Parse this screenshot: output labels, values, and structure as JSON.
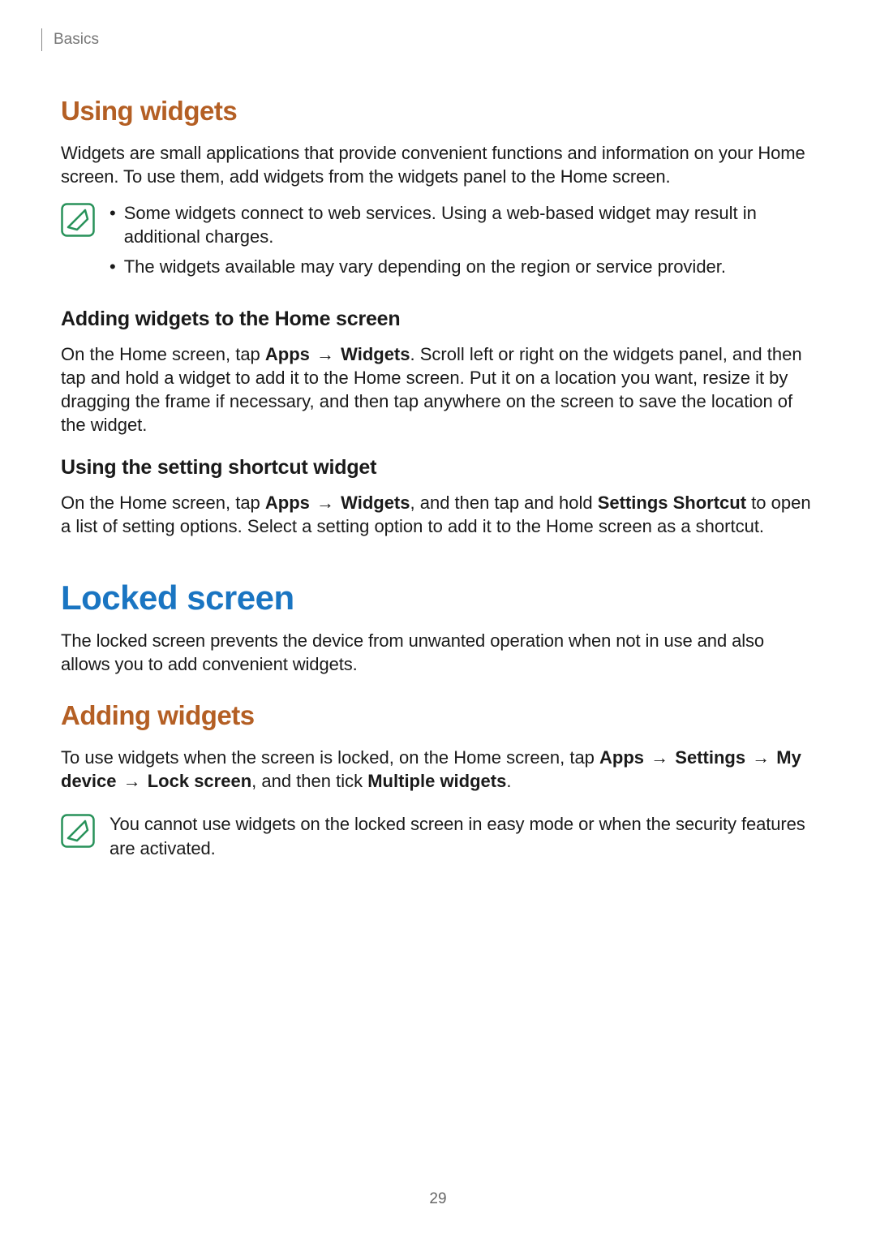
{
  "header": {
    "category": "Basics"
  },
  "section1": {
    "title": "Using widgets",
    "intro": "Widgets are small applications that provide convenient functions and information on your Home screen. To use them, add widgets from the widgets panel to the Home screen.",
    "notes": [
      "Some widgets connect to web services. Using a web-based widget may result in additional charges.",
      "The widgets available may vary depending on the region or service provider."
    ],
    "sub1": {
      "title": "Adding widgets to the Home screen",
      "segments": [
        {
          "t": "On the Home screen, tap ",
          "b": false
        },
        {
          "t": "Apps",
          "b": true
        },
        {
          "t": " → ",
          "b": false,
          "arrow": true
        },
        {
          "t": "Widgets",
          "b": true
        },
        {
          "t": ". Scroll left or right on the widgets panel, and then tap and hold a widget to add it to the Home screen. Put it on a location you want, resize it by dragging the frame if necessary, and then tap anywhere on the screen to save the location of the widget.",
          "b": false
        }
      ]
    },
    "sub2": {
      "title": "Using the setting shortcut widget",
      "segments": [
        {
          "t": "On the Home screen, tap ",
          "b": false
        },
        {
          "t": "Apps",
          "b": true
        },
        {
          "t": " → ",
          "b": false,
          "arrow": true
        },
        {
          "t": "Widgets",
          "b": true
        },
        {
          "t": ", and then tap and hold ",
          "b": false
        },
        {
          "t": "Settings Shortcut",
          "b": true
        },
        {
          "t": " to open a list of setting options. Select a setting option to add it to the Home screen as a shortcut.",
          "b": false
        }
      ]
    }
  },
  "section2": {
    "title": "Locked screen",
    "intro": "The locked screen prevents the device from unwanted operation when not in use and also allows you to add convenient widgets.",
    "sub1": {
      "title": "Adding widgets",
      "segments": [
        {
          "t": "To use widgets when the screen is locked, on the Home screen, tap ",
          "b": false
        },
        {
          "t": "Apps",
          "b": true
        },
        {
          "t": " → ",
          "b": false,
          "arrow": true
        },
        {
          "t": "Settings",
          "b": true
        },
        {
          "t": " → ",
          "b": false,
          "arrow": true
        },
        {
          "t": "My device",
          "b": true
        },
        {
          "t": " → ",
          "b": false,
          "arrow": true
        },
        {
          "t": "Lock screen",
          "b": true
        },
        {
          "t": ", and then tick ",
          "b": false
        },
        {
          "t": "Multiple widgets",
          "b": true
        },
        {
          "t": ".",
          "b": false
        }
      ],
      "note": "You cannot use widgets on the locked screen in easy mode or when the security features are activated."
    }
  },
  "pageNumber": "29"
}
